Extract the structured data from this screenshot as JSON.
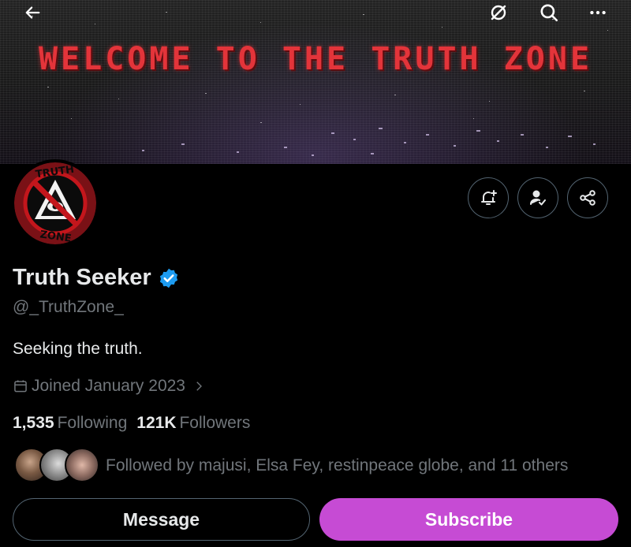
{
  "banner": {
    "title": "WELCOME TO THE TRUTH ZONE",
    "title_color": "#e3343a"
  },
  "top_bar": {
    "icons": [
      "back-arrow-icon",
      "grok-icon",
      "search-icon",
      "more-icon"
    ]
  },
  "avatar": {
    "top_text": "TRUTH",
    "bottom_text": "ZONE",
    "ring_color": "#a0181c"
  },
  "actions": {
    "icons": [
      "notification-bell-plus-icon",
      "follow-check-icon",
      "share-icon"
    ]
  },
  "profile": {
    "name": "Truth Seeker",
    "handle": "@_TruthZone_",
    "bio": "Seeking the truth.",
    "joined": "Joined January 2023",
    "verified_color": "#1d9bf0"
  },
  "stats": {
    "following_count": "1,535",
    "following_label": "Following",
    "followers_count": "121K",
    "followers_label": "Followers"
  },
  "followed_by": {
    "text": "Followed by majusi, Elsa Fey, restinpeace globe, and 11 others"
  },
  "buttons": {
    "message": "Message",
    "subscribe": "Subscribe",
    "subscribe_color": "#c64bd4"
  }
}
